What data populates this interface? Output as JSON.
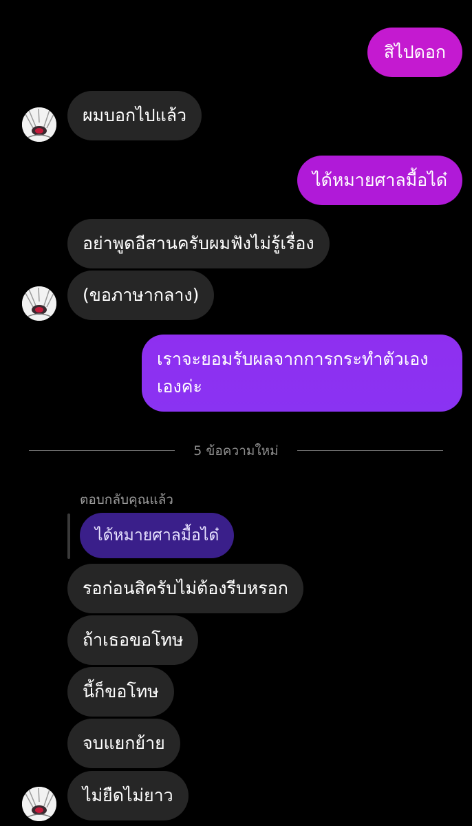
{
  "colors": {
    "background": "#000000",
    "incoming_bubble": "#262626",
    "outgoing_gradient_top": "#c21ad0",
    "outgoing_gradient_bottom": "#8a2ef0",
    "quoted_bubble": "#3a1f8a",
    "divider_text": "#8f8f8f"
  },
  "messages": {
    "m1": {
      "text": "สิไปดอก",
      "direction": "outgoing"
    },
    "m2": {
      "text": "ผมบอกไปแล้ว",
      "direction": "incoming"
    },
    "m3": {
      "text": "ได้หมายศาลมื้อได๋",
      "direction": "outgoing"
    },
    "m4": {
      "text": "อย่าพูดอีสานครับผมฟังไม่รู้เรื่อง",
      "direction": "incoming"
    },
    "m5": {
      "text": "(ขอภาษากลาง)",
      "direction": "incoming"
    },
    "m6": {
      "line1": "เราจะยอมรับผลจากการกระทำตัวเอง",
      "line2": "เองค่ะ",
      "direction": "outgoing"
    },
    "m7": {
      "text": "รอก่อนสิครับไม่ต้องรีบหรอก",
      "direction": "incoming"
    },
    "m8": {
      "text": "ถ้าเธอขอโทษ",
      "direction": "incoming"
    },
    "m9": {
      "text": "นี้ก็ขอโทษ",
      "direction": "incoming"
    },
    "m10": {
      "text": "จบแยกย้าย",
      "direction": "incoming"
    },
    "m11": {
      "text": "ไม่ยืดไม่ยาว",
      "direction": "incoming"
    }
  },
  "divider": {
    "label": "5 ข้อความใหม่"
  },
  "reply": {
    "caption": "ตอบกลับคุณแล้ว",
    "quoted_text": "ได้หมายศาลมื้อได๋"
  },
  "avatar": {
    "icon": "anime-avatar-icon"
  }
}
